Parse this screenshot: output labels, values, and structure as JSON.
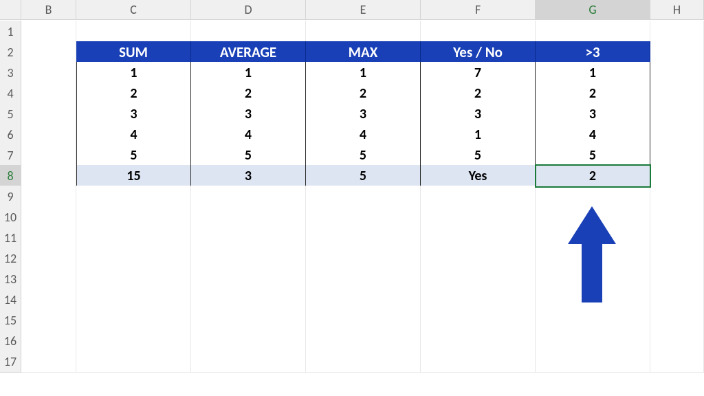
{
  "columns": [
    "",
    "B",
    "C",
    "D",
    "E",
    "F",
    "G",
    "H"
  ],
  "selected_column_index": 6,
  "rows": [
    "1",
    "2",
    "3",
    "4",
    "5",
    "6",
    "7",
    "8",
    "9",
    "10",
    "11",
    "12",
    "13",
    "14",
    "15",
    "16",
    "17"
  ],
  "selected_row_index": 7,
  "table": {
    "headers": [
      "SUM",
      "AVERAGE",
      "MAX",
      "Yes / No",
      ">3"
    ],
    "data": [
      [
        "1",
        "1",
        "1",
        "7",
        "1"
      ],
      [
        "2",
        "2",
        "2",
        "2",
        "2"
      ],
      [
        "3",
        "3",
        "3",
        "3",
        "3"
      ],
      [
        "4",
        "4",
        "4",
        "1",
        "4"
      ],
      [
        "5",
        "5",
        "5",
        "5",
        "5"
      ]
    ],
    "results": [
      "15",
      "3",
      "5",
      "Yes",
      "2"
    ]
  },
  "chart_data": {
    "type": "table",
    "title": "",
    "columns": [
      "SUM",
      "AVERAGE",
      "MAX",
      "Yes / No",
      ">3"
    ],
    "rows": [
      [
        1,
        1,
        1,
        7,
        1
      ],
      [
        2,
        2,
        2,
        2,
        2
      ],
      [
        3,
        3,
        3,
        3,
        3
      ],
      [
        4,
        4,
        4,
        1,
        4
      ],
      [
        5,
        5,
        5,
        5,
        5
      ]
    ],
    "summary": [
      15,
      3,
      5,
      "Yes",
      2
    ]
  },
  "arrow_color": "#1940b6"
}
